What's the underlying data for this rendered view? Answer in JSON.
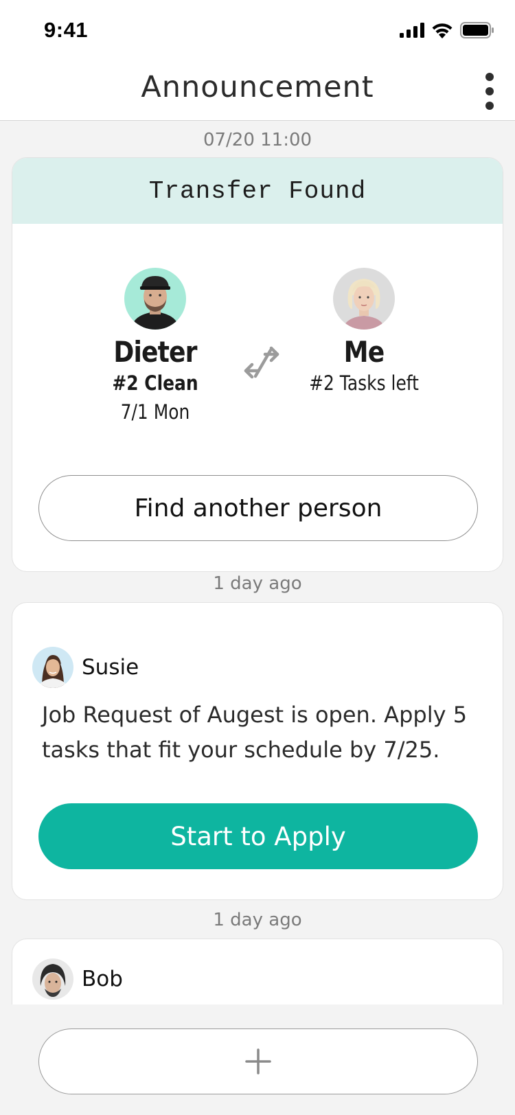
{
  "status_bar": {
    "time": "9:41"
  },
  "nav": {
    "title": "Announcement"
  },
  "feed": [
    {
      "timestamp": "07/20 11:00",
      "header": "Transfer Found",
      "from": {
        "name": "Dieter",
        "task": "#2 Clean",
        "date": "7/1 Mon"
      },
      "to": {
        "name": "Me",
        "tasks_left": "#2 Tasks left"
      },
      "action_label": "Find another person"
    },
    {
      "timestamp": "1 day ago",
      "sender": "Susie",
      "message": "Job Request of Augest is open. Apply 5 tasks that fit your schedule by 7/25.",
      "action_label": "Start to Apply"
    },
    {
      "timestamp": "1 day ago",
      "sender": "Bob"
    }
  ],
  "colors": {
    "accent": "#0eb5a0",
    "header_tint": "#dbf0ed",
    "background": "#f3f3f3"
  },
  "icons": [
    "signal-icon",
    "wifi-icon",
    "battery-icon",
    "more-vertical-icon",
    "swap-arrows-icon",
    "plus-icon"
  ]
}
